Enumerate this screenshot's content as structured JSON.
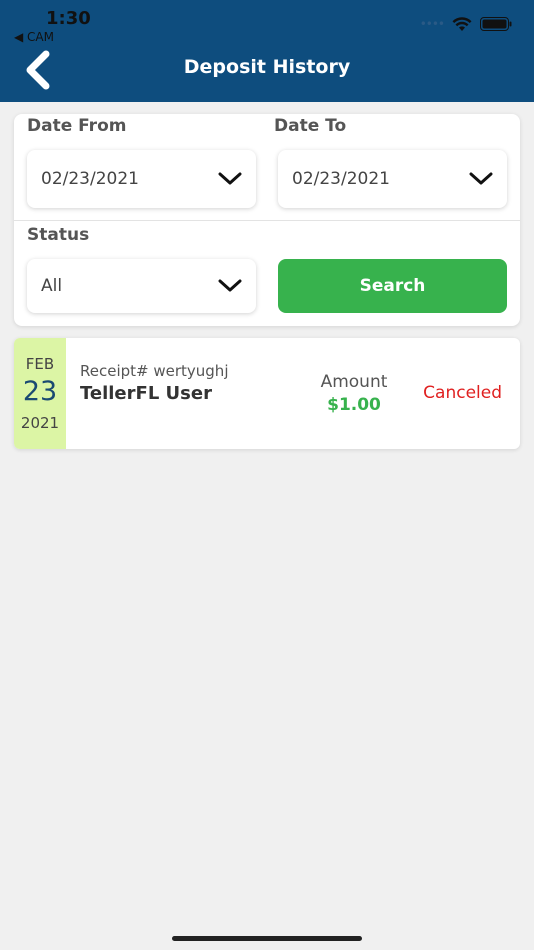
{
  "statusbar": {
    "time": "1:30",
    "back_app": "◀ CAM",
    "signal": "••••"
  },
  "header": {
    "title": "Deposit History",
    "back_icon": "chevron-left-icon"
  },
  "filters": {
    "date_from_label": "Date From",
    "date_from_value": "02/23/2021",
    "date_to_label": "Date To",
    "date_to_value": "02/23/2021",
    "status_label": "Status",
    "status_value": "All",
    "search_label": "Search"
  },
  "records": [
    {
      "month": "FEB",
      "day": "23",
      "year": "2021",
      "receipt": "Receipt# wertyughj",
      "user": "TellerFL User",
      "amount_label": "Amount",
      "amount": "$1.00",
      "status": "Canceled"
    }
  ],
  "colors": {
    "header_bg": "#0e4d7e",
    "accent_green": "#37b24d",
    "status_canceled": "#e02020",
    "date_block_bg": "#dcf5a5"
  }
}
